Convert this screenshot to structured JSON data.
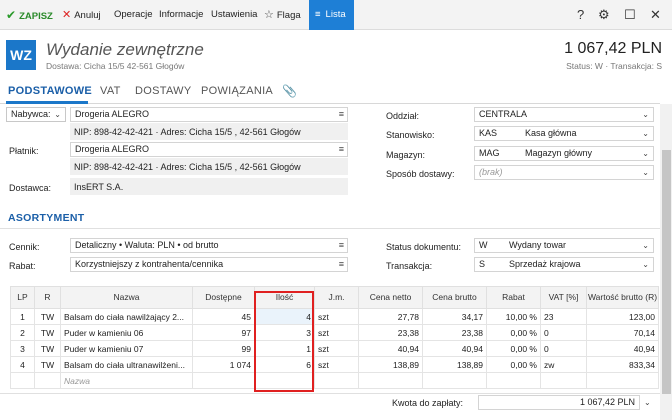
{
  "toolbar": {
    "save": "ZAPISZ",
    "cancel": "Anuluj",
    "operations": "Operacje",
    "info": "Informacje",
    "settings": "Ustawienia",
    "flag": "Flaga",
    "list": "Lista",
    "help": "?",
    "gear": "⚙",
    "maximize": "☐",
    "close": "✕"
  },
  "header": {
    "code": "WZ",
    "title": "Wydanie zewnętrzne",
    "subtitle": "Dostawa: Cicha  15/5  42-561 Głogów",
    "amount": "1 067,42 PLN",
    "status": "Status:  W  ·  Transakcja:  S"
  },
  "tabs": [
    "PODSTAWOWE",
    "VAT",
    "DOSTAWY",
    "POWIĄZANIA"
  ],
  "left_form": {
    "buyer_label": "Nabywca:",
    "buyer_value": "Drogeria ALEGRO",
    "buyer_details": "NIP:  898-42-42-421  ·  Adres:  Cicha  15/5 , 42-561 Głogów",
    "payer_label": "Płatnik:",
    "payer_value": "Drogeria ALEGRO",
    "payer_details": "NIP:  898-42-42-421  ·  Adres:  Cicha  15/5 , 42-561 Głogów",
    "supplier_label": "Dostawca:",
    "supplier_value": "InsERT S.A."
  },
  "right_form": {
    "branch_label": "Oddział:",
    "branch_value": "CENTRALA",
    "station_label": "Stanowisko:",
    "station_code": "KAS",
    "station_name": "Kasa główna",
    "warehouse_label": "Magazyn:",
    "warehouse_code": "MAG",
    "warehouse_name": "Magazyn główny",
    "delivery_label": "Sposób dostawy:",
    "delivery_value": "(brak)"
  },
  "assortment": {
    "title": "ASORTYMENT",
    "pricelist_label": "Cennik:",
    "pricelist_value": "Detaliczny • Waluta: PLN • od brutto",
    "discount_label": "Rabat:",
    "discount_value": "Korzystniejszy z kontrahenta/cennika",
    "docstatus_label": "Status dokumentu:",
    "docstatus_code": "W",
    "docstatus_name": "Wydany towar",
    "transaction_label": "Transakcja:",
    "transaction_code": "S",
    "transaction_name": "Sprzedaż krajowa"
  },
  "table": {
    "headers": [
      "LP",
      "R",
      "Nazwa",
      "Dostępne",
      "Ilość",
      "J.m.",
      "Cena netto",
      "Cena brutto",
      "Rabat",
      "VAT [%]",
      "Wartość brutto (R)"
    ],
    "rows": [
      [
        "1",
        "TW",
        "Balsam do ciała nawilżający 2...",
        "45",
        "4",
        "szt",
        "27,78",
        "34,17",
        "10,00 %",
        "23",
        "123,00"
      ],
      [
        "2",
        "TW",
        "Puder w kamieniu 06",
        "97",
        "3",
        "szt",
        "23,38",
        "23,38",
        "0,00 %",
        "0",
        "70,14"
      ],
      [
        "3",
        "TW",
        "Puder w kamieniu 07",
        "99",
        "1",
        "szt",
        "40,94",
        "40,94",
        "0,00 %",
        "0",
        "40,94"
      ],
      [
        "4",
        "TW",
        "Balsam do ciała ultranawilżeni...",
        "1 074",
        "6",
        "szt",
        "138,89",
        "138,89",
        "0,00 %",
        "zw",
        "833,34"
      ]
    ],
    "new_row_placeholder": "Nazwa"
  },
  "footer": {
    "total_label": "Kwota do zapłaty:",
    "total_value": "1 067,42 PLN"
  },
  "colors": {
    "accent": "#1b77c9",
    "save_green": "#2a8a2a",
    "cancel_red": "#d22222",
    "highlight_red": "#e02020"
  }
}
